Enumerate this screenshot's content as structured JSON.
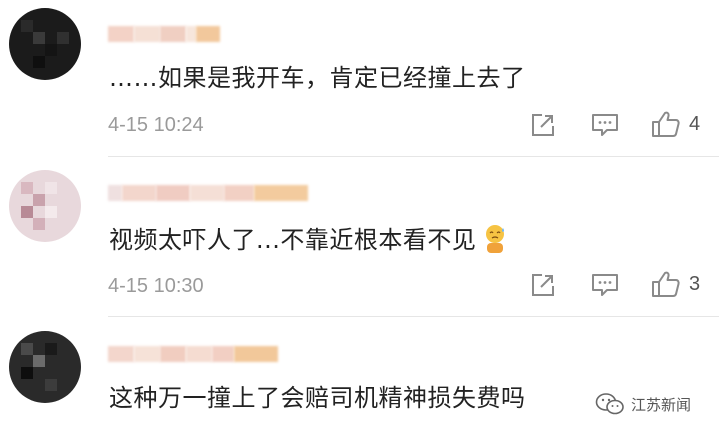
{
  "comments": [
    {
      "text": "……如果是我开车，肯定已经撞上去了",
      "time": "4-15 10:24",
      "likes": "4"
    },
    {
      "text": "视频太吓人了...不靠近根本看不见",
      "time": "4-15 10:30",
      "likes": "3"
    },
    {
      "text": "这种万一撞上了会赔司机精神损失费吗"
    }
  ],
  "icons": {
    "share": "share-icon",
    "comment": "comment-icon",
    "like": "like-icon",
    "emoji": "sweat-emoji-icon",
    "wechat": "wechat-icon"
  },
  "colors": {
    "text": "#222222",
    "meta": "#9a9a9a",
    "icon": "#8a8a8a",
    "divider": "#e6e6e6"
  },
  "watermark": {
    "label": "江苏新闻"
  }
}
